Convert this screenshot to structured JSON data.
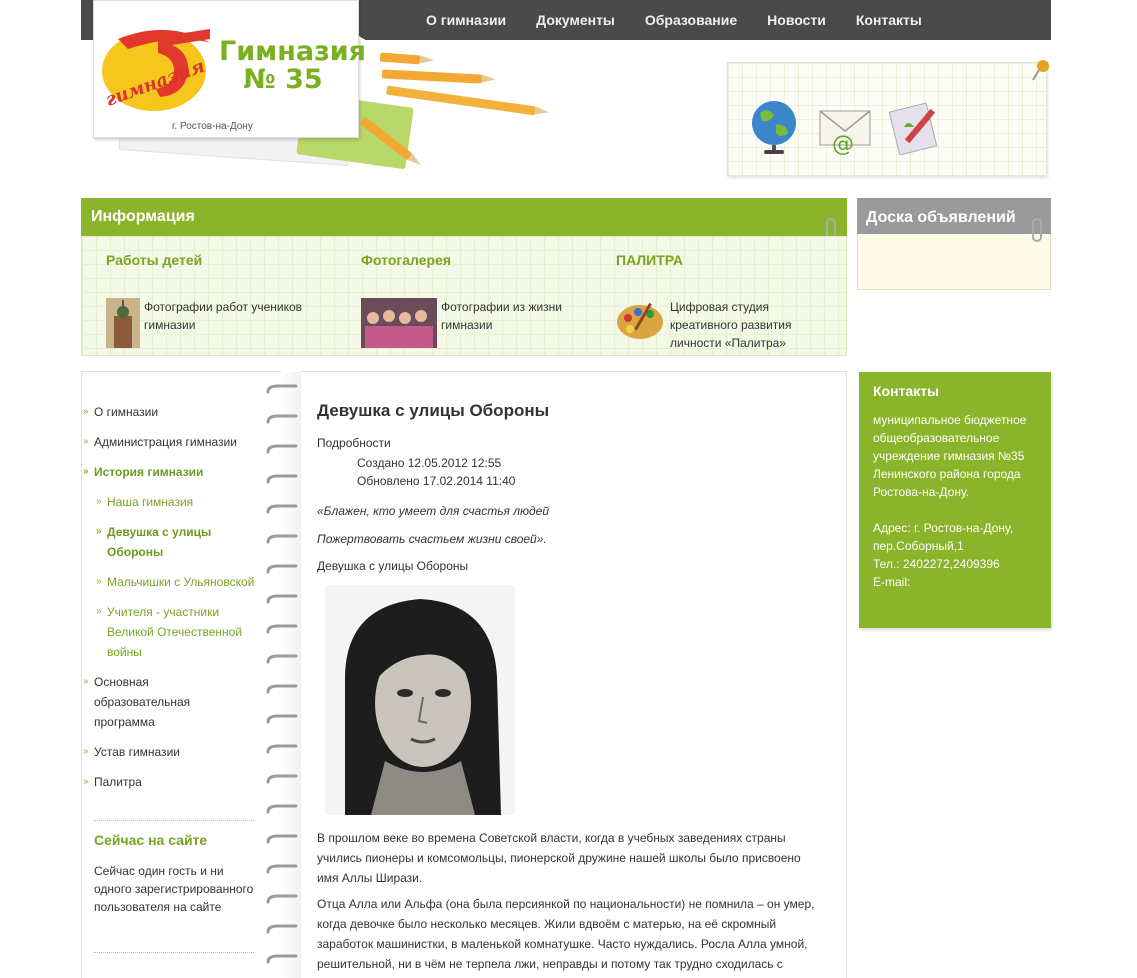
{
  "nav": {
    "items": [
      "О гимназии",
      "Документы",
      "Образование",
      "Новости",
      "Контакты"
    ]
  },
  "logo": {
    "title_line1": "Гимназия",
    "title_line2": "№ 35",
    "city": "г. Ростов-на-Дону",
    "emblem_text": "гимназия"
  },
  "info": {
    "title": "Информация",
    "columns": [
      {
        "title": "Работы детей",
        "text": "Фотографии работ учеников гимназии"
      },
      {
        "title": "Фотогалерея",
        "text": "Фотографии из жизни гимназии"
      },
      {
        "title": "ПАЛИТРА",
        "text": "Цифровая студия креативного развития личности «Палитра»"
      }
    ]
  },
  "board": {
    "title": "Доска объявлений"
  },
  "sidebar": {
    "menu": [
      {
        "label": "О гимназии",
        "level": 0,
        "active": false
      },
      {
        "label": "Администрация гимназии",
        "level": 0,
        "active": false
      },
      {
        "label": "История гимназии",
        "level": 0,
        "active": true
      },
      {
        "label": "Наша гимназия",
        "level": 1,
        "active": false
      },
      {
        "label": "Девушка с улицы Обороны",
        "level": 1,
        "active": true
      },
      {
        "label": "Мальчишки с Ульяновской",
        "level": 1,
        "active": false
      },
      {
        "label": "Учителя - участники Великой Отечественной войны",
        "level": 1,
        "active": false
      },
      {
        "label": "Основная образовательная программа",
        "level": 0,
        "active": false
      },
      {
        "label": "Устав гимназии",
        "level": 0,
        "active": false
      },
      {
        "label": "Палитра",
        "level": 0,
        "active": false
      }
    ],
    "online_title": "Сейчас на сайте",
    "online_text": "Сейчас один гость и ни одного зарегистрированного пользователя на сайте"
  },
  "article": {
    "title": "Девушка с улицы Обороны",
    "details_label": "Подробности",
    "created": "Создано 12.05.2012 12:55",
    "updated": "Обновлено 17.02.2014 11:40",
    "quote1": "«Блажен, кто умеет для счастья людей",
    "quote2": "Пожертвовать счастьем жизни своей».",
    "caption": "Девушка с улицы Обороны",
    "para1": "В прошлом веке во времена Советской власти, когда в учебных заведениях страны учились пионеры и комсомольцы, пионерской дружине нашей школы было присвоено имя Аллы Ширази.",
    "para2": "Отца Алла или Альфа (она была персиянкой по национальности) не помнила – он умер, когда девочке было несколько месяцев. Жили вдвоём с матерью, на её скромный заработок машинистки, в маленькой комнатушке. Часто нуждались. Росла Алла умной, решительной, ни в чём не терпела лжи, неправды и потому так трудно сходилась с подругами. Запоем читала. Любила Пушкина, Гоголя. Когда попалась в руки «Война и"
  },
  "contacts": {
    "title": "Контакты",
    "org": "муниципальное бюджетное общеобразовательное учреждение гимназия №35 Ленинского района города Ростова-на-Дону.",
    "address": "Адрес: г. Ростов-на-Дону, пер.Соборный,1",
    "phone": "Тел.: 2402272,2409396",
    "email": "E-mail:"
  },
  "colors": {
    "accent": "#8ab42a",
    "nav_bg": "#4a4a4a",
    "board_bg": "#9a9a9a"
  },
  "icons": [
    "globe-icon",
    "mail-icon",
    "pencil-paper-icon",
    "pin-icon",
    "palette-icon"
  ]
}
